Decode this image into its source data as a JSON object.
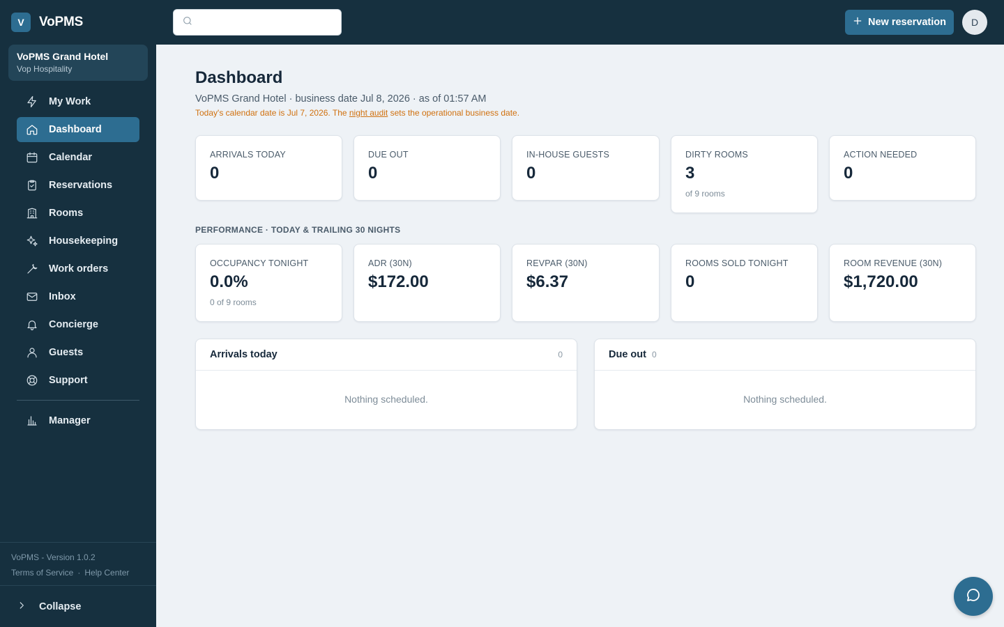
{
  "app": {
    "logo_letter": "V",
    "name": "VoPMS"
  },
  "hotel": {
    "name": "VoPMS Grand Hotel",
    "org": "Vop Hospitality"
  },
  "sidebar": {
    "items": [
      {
        "label": "My Work",
        "icon": "lightning-icon"
      },
      {
        "label": "Dashboard",
        "icon": "home-icon",
        "active": true
      },
      {
        "label": "Calendar",
        "icon": "calendar-icon"
      },
      {
        "label": "Reservations",
        "icon": "clipboard-check-icon"
      },
      {
        "label": "Rooms",
        "icon": "building-icon"
      },
      {
        "label": "Housekeeping",
        "icon": "sparkles-icon"
      },
      {
        "label": "Work orders",
        "icon": "wrench-icon"
      },
      {
        "label": "Inbox",
        "icon": "mail-icon"
      },
      {
        "label": "Concierge",
        "icon": "bell-icon"
      },
      {
        "label": "Guests",
        "icon": "user-icon"
      },
      {
        "label": "Support",
        "icon": "lifebuoy-icon"
      },
      {
        "label": "Manager",
        "icon": "bar-chart-icon"
      }
    ],
    "version": "VoPMS - Version 1.0.2",
    "terms": "Terms of Service",
    "separator": "·",
    "help": "Help Center",
    "collapse": "Collapse"
  },
  "topbar": {
    "search_placeholder": "",
    "new_reservation": "New reservation",
    "avatar_initial": "D"
  },
  "page": {
    "title": "Dashboard",
    "subtitle": "VoPMS Grand Hotel · business date Jul 8, 2026 · as of 01:57 AM",
    "notice_pre": "Today's calendar date is Jul 7, 2026. The ",
    "notice_link": "night audit",
    "notice_post": " sets the operational business date."
  },
  "stats": [
    {
      "label": "ARRIVALS TODAY",
      "value": "0"
    },
    {
      "label": "DUE OUT",
      "value": "0"
    },
    {
      "label": "IN-HOUSE GUESTS",
      "value": "0"
    },
    {
      "label": "DIRTY ROOMS",
      "value": "3",
      "sub": "of 9 rooms"
    },
    {
      "label": "ACTION NEEDED",
      "value": "0"
    }
  ],
  "performance": {
    "section_label": "PERFORMANCE · TODAY & TRAILING 30 NIGHTS",
    "cards": [
      {
        "label": "OCCUPANCY TONIGHT",
        "value": "0.0%",
        "sub": "0 of 9 rooms"
      },
      {
        "label": "ADR (30N)",
        "value": "$172.00"
      },
      {
        "label": "REVPAR (30N)",
        "value": "$6.37"
      },
      {
        "label": "ROOMS SOLD TONIGHT",
        "value": "0"
      },
      {
        "label": "ROOM REVENUE (30N)",
        "value": "$1,720.00"
      }
    ]
  },
  "panels": {
    "arrivals": {
      "title": "Arrivals today",
      "count": "0",
      "empty": "Nothing scheduled."
    },
    "due_out": {
      "title": "Due out",
      "count": "0",
      "empty": "Nothing scheduled."
    }
  },
  "colors": {
    "sidebar": "#16303f",
    "accent": "#2d6d91",
    "background": "#eef2f6",
    "notice": "#d0700e"
  }
}
